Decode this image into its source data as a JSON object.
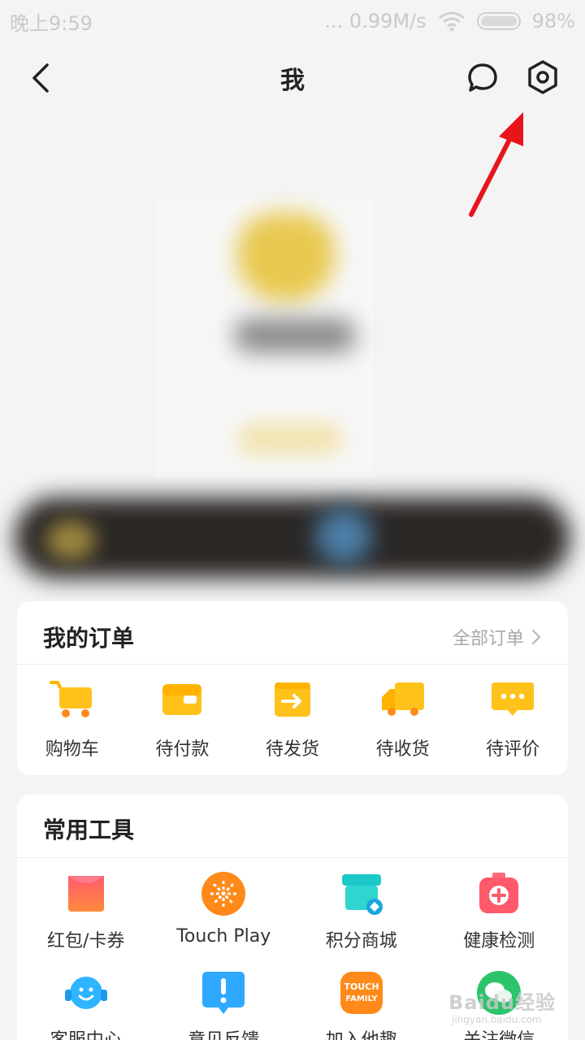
{
  "status_bar": {
    "time": "晚上9:59",
    "network_speed": "... 0.99M/s",
    "battery": "98%",
    "icons": [
      "wifi-icon",
      "battery-icon"
    ]
  },
  "nav": {
    "title": "我",
    "icons": [
      "back-arrow-icon",
      "message-icon",
      "settings-hex-icon"
    ]
  },
  "orders": {
    "title": "我的订单",
    "all_link": "全部订单",
    "items": [
      {
        "label": "购物车",
        "icon": "cart-icon"
      },
      {
        "label": "待付款",
        "icon": "wallet-icon"
      },
      {
        "label": "待发货",
        "icon": "box-arrow-icon"
      },
      {
        "label": "待收货",
        "icon": "truck-icon"
      },
      {
        "label": "待评价",
        "icon": "comment-dots-icon"
      }
    ]
  },
  "tools": {
    "title": "常用工具",
    "items": [
      {
        "label": "红包/卡券",
        "icon": "red-packet-icon"
      },
      {
        "label": "Touch Play",
        "icon": "touch-play-icon"
      },
      {
        "label": "积分商城",
        "icon": "points-store-icon"
      },
      {
        "label": "健康检测",
        "icon": "health-kit-icon"
      },
      {
        "label": "客服中心",
        "icon": "customer-service-icon"
      },
      {
        "label": "意见反馈",
        "icon": "feedback-icon"
      },
      {
        "label": "加入他趣",
        "icon": "touch-family-icon"
      },
      {
        "label": "关注微信",
        "icon": "wechat-follow-icon"
      }
    ],
    "touch_family_text": "TOUCH FAMILY"
  },
  "watermark": {
    "text": "Baidu经验",
    "sub": "jingyan.baidu.com"
  },
  "colors": {
    "accent_yellow": "#ffc21a",
    "arrow_red": "#e8141b",
    "background": "#f4f4f4"
  }
}
